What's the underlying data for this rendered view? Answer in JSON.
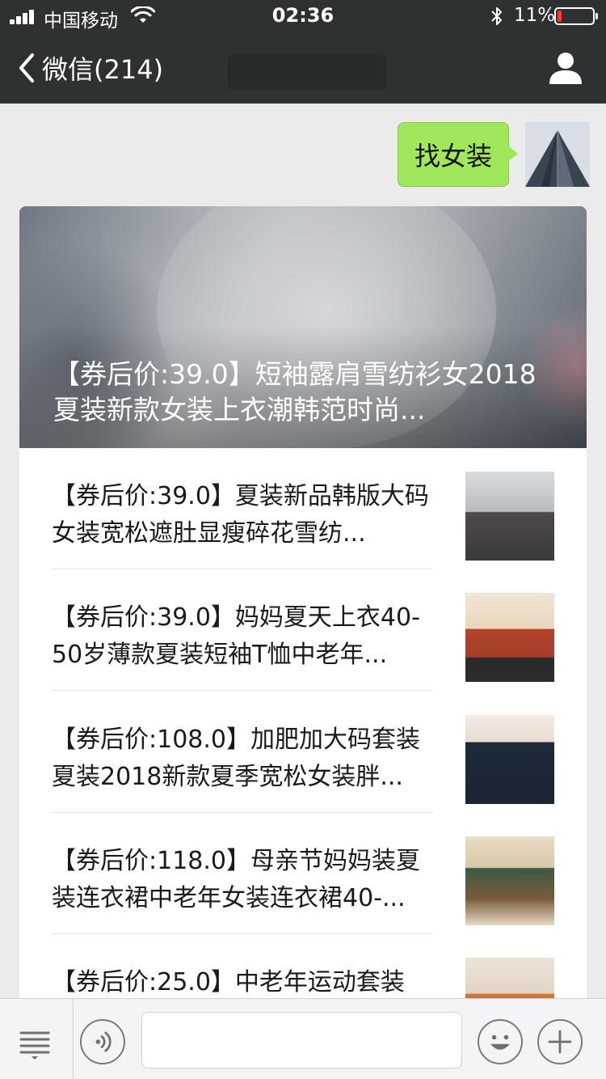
{
  "status_bar": {
    "carrier": "中国移动",
    "time": "02:36",
    "battery_percent": "11%",
    "battery_level": 0.11,
    "icons": [
      "signal-icon",
      "wifi-icon",
      "bluetooth-icon",
      "battery-icon"
    ]
  },
  "nav": {
    "back_label": "微信(214)",
    "back_icon": "chevron-left-icon",
    "profile_icon": "person-icon"
  },
  "chat": {
    "sent_message": "找女装",
    "card": {
      "hero_title": "【券后价:39.0】短袖露肩雪纺衫女2018夏装新款女装上衣潮韩范时尚...",
      "items": [
        {
          "text": "【券后价:39.0】夏装新品韩版大码女装宽松遮肚显瘦碎花雪纺..."
        },
        {
          "text": "【券后价:39.0】妈妈夏天上衣40-50岁薄款夏装短袖T恤中老年..."
        },
        {
          "text": "【券后价:108.0】加肥加大码套装夏装2018新款夏季宽松女装胖..."
        },
        {
          "text": "【券后价:118.0】母亲节妈妈装夏装连衣裙中老年女装连衣裙40-..."
        },
        {
          "text": "【券后价:25.0】中老年运动套装"
        }
      ]
    }
  },
  "input_bar": {
    "menu_icon": "menu-list-icon",
    "voice_icon": "voice-icon",
    "text_value": "",
    "emoji_icon": "emoji-icon",
    "plus_icon": "plus-icon"
  },
  "colors": {
    "nav_background": "#2e3132",
    "bubble_green": "#a0e75a",
    "chat_background": "#ebebeb",
    "battery_low": "#ff3b30"
  }
}
